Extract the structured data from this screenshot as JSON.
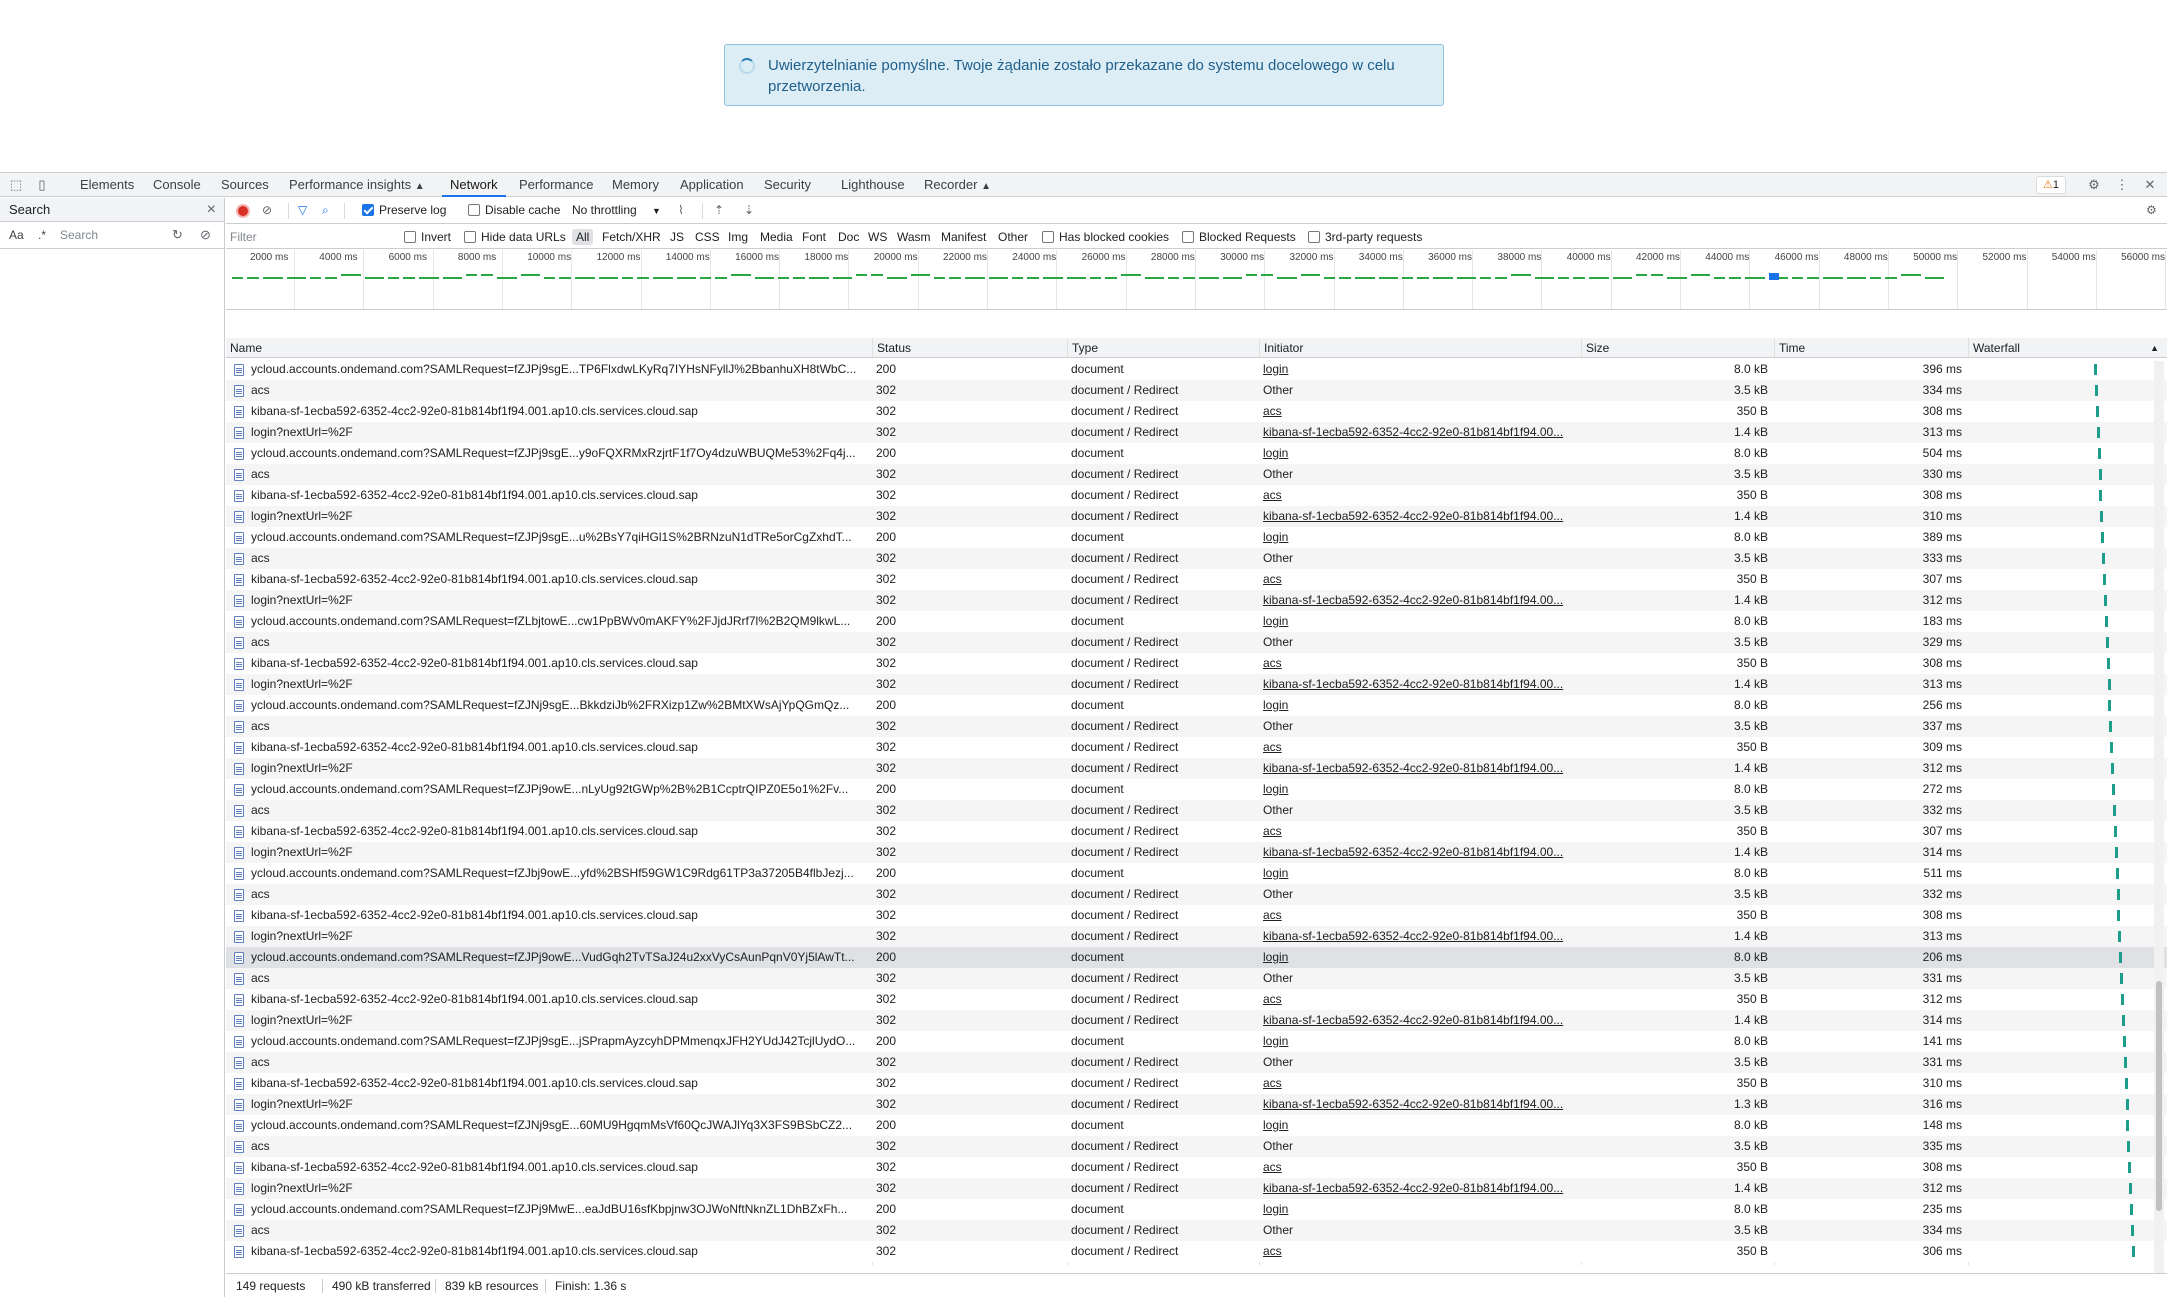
{
  "alert": {
    "message": "Uwierzytelnianie pomyślne. Twoje żądanie zostało przekazane do systemu docelowego w celu przetworzenia."
  },
  "devtools": {
    "tabs": [
      "Elements",
      "Console",
      "Sources",
      "Performance insights",
      "Network",
      "Performance",
      "Memory",
      "Application",
      "Security",
      "Lighthouse",
      "Recorder"
    ],
    "active_tab": "Network",
    "warnings": "1",
    "warn_symbol": "⚠"
  },
  "search_panel": {
    "title": "Search",
    "case_toggle": "Aa",
    "regex_toggle": ".*",
    "placeholder": "Search"
  },
  "toolbar": {
    "preserve_log": "Preserve log",
    "disable_cache": "Disable cache",
    "throttling": "No throttling"
  },
  "filterbar": {
    "placeholder": "Filter",
    "invert": "Invert",
    "hide_data_urls": "Hide data URLs",
    "types": [
      "All",
      "Fetch/XHR",
      "JS",
      "CSS",
      "Img",
      "Media",
      "Font",
      "Doc",
      "WS",
      "Wasm",
      "Manifest",
      "Other"
    ],
    "has_blocked_cookies": "Has blocked cookies",
    "blocked_requests": "Blocked Requests",
    "third_party": "3rd-party requests"
  },
  "overview": {
    "ticks": [
      "2000 ms",
      "4000 ms",
      "6000 ms",
      "8000 ms",
      "10000 ms",
      "12000 ms",
      "14000 ms",
      "16000 ms",
      "18000 ms",
      "20000 ms",
      "22000 ms",
      "24000 ms",
      "26000 ms",
      "28000 ms",
      "30000 ms",
      "32000 ms",
      "34000 ms",
      "36000 ms",
      "38000 ms",
      "40000 ms",
      "42000 ms",
      "44000 ms",
      "46000 ms",
      "48000 ms",
      "50000 ms",
      "52000 ms",
      "54000 ms",
      "56000 ms"
    ]
  },
  "columns": {
    "name": "Name",
    "status": "Status",
    "type": "Type",
    "initiator": "Initiator",
    "size": "Size",
    "time": "Time",
    "waterfall": "Waterfall"
  },
  "rows": [
    {
      "name": "ycloud.accounts.ondemand.com?SAMLRequest=fZJPj9sgE...TP6FlxdwLKyRq7IYHsNFyllJ%2BbanhuXH8tWbC...",
      "status": "200",
      "type": "document",
      "initiator": "login",
      "link": true,
      "size": "8.0 kB",
      "time": "396 ms"
    },
    {
      "name": "acs",
      "status": "302",
      "type": "document / Redirect",
      "initiator": "Other",
      "link": false,
      "size": "3.5 kB",
      "time": "334 ms"
    },
    {
      "name": "kibana-sf-1ecba592-6352-4cc2-92e0-81b814bf1f94.001.ap10.cls.services.cloud.sap",
      "status": "302",
      "type": "document / Redirect",
      "initiator": "acs",
      "link": true,
      "size": "350 B",
      "time": "308 ms"
    },
    {
      "name": "login?nextUrl=%2F",
      "status": "302",
      "type": "document / Redirect",
      "initiator": "kibana-sf-1ecba592-6352-4cc2-92e0-81b814bf1f94.00...",
      "link": true,
      "size": "1.4 kB",
      "time": "313 ms"
    },
    {
      "name": "ycloud.accounts.ondemand.com?SAMLRequest=fZJPj9sgE...y9oFQXRMxRzjrtF1f7Oy4dzuWBUQMe53%2Fq4j...",
      "status": "200",
      "type": "document",
      "initiator": "login",
      "link": true,
      "size": "8.0 kB",
      "time": "504 ms"
    },
    {
      "name": "acs",
      "status": "302",
      "type": "document / Redirect",
      "initiator": "Other",
      "link": false,
      "size": "3.5 kB",
      "time": "330 ms"
    },
    {
      "name": "kibana-sf-1ecba592-6352-4cc2-92e0-81b814bf1f94.001.ap10.cls.services.cloud.sap",
      "status": "302",
      "type": "document / Redirect",
      "initiator": "acs",
      "link": true,
      "size": "350 B",
      "time": "308 ms"
    },
    {
      "name": "login?nextUrl=%2F",
      "status": "302",
      "type": "document / Redirect",
      "initiator": "kibana-sf-1ecba592-6352-4cc2-92e0-81b814bf1f94.00...",
      "link": true,
      "size": "1.4 kB",
      "time": "310 ms"
    },
    {
      "name": "ycloud.accounts.ondemand.com?SAMLRequest=fZJPj9sgE...u%2BsY7qiHGl1S%2BRNzuN1dTRe5orCgZxhdT...",
      "status": "200",
      "type": "document",
      "initiator": "login",
      "link": true,
      "size": "8.0 kB",
      "time": "389 ms"
    },
    {
      "name": "acs",
      "status": "302",
      "type": "document / Redirect",
      "initiator": "Other",
      "link": false,
      "size": "3.5 kB",
      "time": "333 ms"
    },
    {
      "name": "kibana-sf-1ecba592-6352-4cc2-92e0-81b814bf1f94.001.ap10.cls.services.cloud.sap",
      "status": "302",
      "type": "document / Redirect",
      "initiator": "acs",
      "link": true,
      "size": "350 B",
      "time": "307 ms"
    },
    {
      "name": "login?nextUrl=%2F",
      "status": "302",
      "type": "document / Redirect",
      "initiator": "kibana-sf-1ecba592-6352-4cc2-92e0-81b814bf1f94.00...",
      "link": true,
      "size": "1.4 kB",
      "time": "312 ms"
    },
    {
      "name": "ycloud.accounts.ondemand.com?SAMLRequest=fZLbjtowE...cw1PpBWv0mAKFY%2FJjdJRrf7l%2B2QM9lkwL...",
      "status": "200",
      "type": "document",
      "initiator": "login",
      "link": true,
      "size": "8.0 kB",
      "time": "183 ms"
    },
    {
      "name": "acs",
      "status": "302",
      "type": "document / Redirect",
      "initiator": "Other",
      "link": false,
      "size": "3.5 kB",
      "time": "329 ms"
    },
    {
      "name": "kibana-sf-1ecba592-6352-4cc2-92e0-81b814bf1f94.001.ap10.cls.services.cloud.sap",
      "status": "302",
      "type": "document / Redirect",
      "initiator": "acs",
      "link": true,
      "size": "350 B",
      "time": "308 ms"
    },
    {
      "name": "login?nextUrl=%2F",
      "status": "302",
      "type": "document / Redirect",
      "initiator": "kibana-sf-1ecba592-6352-4cc2-92e0-81b814bf1f94.00...",
      "link": true,
      "size": "1.4 kB",
      "time": "313 ms"
    },
    {
      "name": "ycloud.accounts.ondemand.com?SAMLRequest=fZJNj9sgE...BkkdziJb%2FRXizp1Zw%2BMtXWsAjYpQGmQz...",
      "status": "200",
      "type": "document",
      "initiator": "login",
      "link": true,
      "size": "8.0 kB",
      "time": "256 ms"
    },
    {
      "name": "acs",
      "status": "302",
      "type": "document / Redirect",
      "initiator": "Other",
      "link": false,
      "size": "3.5 kB",
      "time": "337 ms"
    },
    {
      "name": "kibana-sf-1ecba592-6352-4cc2-92e0-81b814bf1f94.001.ap10.cls.services.cloud.sap",
      "status": "302",
      "type": "document / Redirect",
      "initiator": "acs",
      "link": true,
      "size": "350 B",
      "time": "309 ms"
    },
    {
      "name": "login?nextUrl=%2F",
      "status": "302",
      "type": "document / Redirect",
      "initiator": "kibana-sf-1ecba592-6352-4cc2-92e0-81b814bf1f94.00...",
      "link": true,
      "size": "1.4 kB",
      "time": "312 ms"
    },
    {
      "name": "ycloud.accounts.ondemand.com?SAMLRequest=fZJPj9owE...nLyUg92tGWp%2B%2B1CcptrQIPZ0E5o1%2Fv...",
      "status": "200",
      "type": "document",
      "initiator": "login",
      "link": true,
      "size": "8.0 kB",
      "time": "272 ms"
    },
    {
      "name": "acs",
      "status": "302",
      "type": "document / Redirect",
      "initiator": "Other",
      "link": false,
      "size": "3.5 kB",
      "time": "332 ms"
    },
    {
      "name": "kibana-sf-1ecba592-6352-4cc2-92e0-81b814bf1f94.001.ap10.cls.services.cloud.sap",
      "status": "302",
      "type": "document / Redirect",
      "initiator": "acs",
      "link": true,
      "size": "350 B",
      "time": "307 ms"
    },
    {
      "name": "login?nextUrl=%2F",
      "status": "302",
      "type": "document / Redirect",
      "initiator": "kibana-sf-1ecba592-6352-4cc2-92e0-81b814bf1f94.00...",
      "link": true,
      "size": "1.4 kB",
      "time": "314 ms"
    },
    {
      "name": "ycloud.accounts.ondemand.com?SAMLRequest=fZJbj9owE...yfd%2BSHf59GW1C9Rdg61TP3a37205B4flbJezj...",
      "status": "200",
      "type": "document",
      "initiator": "login",
      "link": true,
      "size": "8.0 kB",
      "time": "511 ms"
    },
    {
      "name": "acs",
      "status": "302",
      "type": "document / Redirect",
      "initiator": "Other",
      "link": false,
      "size": "3.5 kB",
      "time": "332 ms"
    },
    {
      "name": "kibana-sf-1ecba592-6352-4cc2-92e0-81b814bf1f94.001.ap10.cls.services.cloud.sap",
      "status": "302",
      "type": "document / Redirect",
      "initiator": "acs",
      "link": true,
      "size": "350 B",
      "time": "308 ms"
    },
    {
      "name": "login?nextUrl=%2F",
      "status": "302",
      "type": "document / Redirect",
      "initiator": "kibana-sf-1ecba592-6352-4cc2-92e0-81b814bf1f94.00...",
      "link": true,
      "size": "1.4 kB",
      "time": "313 ms"
    },
    {
      "name": "ycloud.accounts.ondemand.com?SAMLRequest=fZJPj9owE...VudGqh2TvTSaJ24u2xxVyCsAunPqnV0Yj5lAwTt...",
      "status": "200",
      "type": "document",
      "initiator": "login",
      "link": true,
      "size": "8.0 kB",
      "time": "206 ms",
      "selected": true
    },
    {
      "name": "acs",
      "status": "302",
      "type": "document / Redirect",
      "initiator": "Other",
      "link": false,
      "size": "3.5 kB",
      "time": "331 ms"
    },
    {
      "name": "kibana-sf-1ecba592-6352-4cc2-92e0-81b814bf1f94.001.ap10.cls.services.cloud.sap",
      "status": "302",
      "type": "document / Redirect",
      "initiator": "acs",
      "link": true,
      "size": "350 B",
      "time": "312 ms"
    },
    {
      "name": "login?nextUrl=%2F",
      "status": "302",
      "type": "document / Redirect",
      "initiator": "kibana-sf-1ecba592-6352-4cc2-92e0-81b814bf1f94.00...",
      "link": true,
      "size": "1.4 kB",
      "time": "314 ms"
    },
    {
      "name": "ycloud.accounts.ondemand.com?SAMLRequest=fZJPj9sgE...jSPrapmAyzcyhDPMmenqxJFH2YUdJ42TcjlUydO...",
      "status": "200",
      "type": "document",
      "initiator": "login",
      "link": true,
      "size": "8.0 kB",
      "time": "141 ms"
    },
    {
      "name": "acs",
      "status": "302",
      "type": "document / Redirect",
      "initiator": "Other",
      "link": false,
      "size": "3.5 kB",
      "time": "331 ms"
    },
    {
      "name": "kibana-sf-1ecba592-6352-4cc2-92e0-81b814bf1f94.001.ap10.cls.services.cloud.sap",
      "status": "302",
      "type": "document / Redirect",
      "initiator": "acs",
      "link": true,
      "size": "350 B",
      "time": "310 ms"
    },
    {
      "name": "login?nextUrl=%2F",
      "status": "302",
      "type": "document / Redirect",
      "initiator": "kibana-sf-1ecba592-6352-4cc2-92e0-81b814bf1f94.00...",
      "link": true,
      "size": "1.3 kB",
      "time": "316 ms"
    },
    {
      "name": "ycloud.accounts.ondemand.com?SAMLRequest=fZJNj9sgE...60MU9HgqmMsVf60QcJWAJlYq3X3FS9BSbCZ2...",
      "status": "200",
      "type": "document",
      "initiator": "login",
      "link": true,
      "size": "8.0 kB",
      "time": "148 ms"
    },
    {
      "name": "acs",
      "status": "302",
      "type": "document / Redirect",
      "initiator": "Other",
      "link": false,
      "size": "3.5 kB",
      "time": "335 ms"
    },
    {
      "name": "kibana-sf-1ecba592-6352-4cc2-92e0-81b814bf1f94.001.ap10.cls.services.cloud.sap",
      "status": "302",
      "type": "document / Redirect",
      "initiator": "acs",
      "link": true,
      "size": "350 B",
      "time": "308 ms"
    },
    {
      "name": "login?nextUrl=%2F",
      "status": "302",
      "type": "document / Redirect",
      "initiator": "kibana-sf-1ecba592-6352-4cc2-92e0-81b814bf1f94.00...",
      "link": true,
      "size": "1.4 kB",
      "time": "312 ms"
    },
    {
      "name": "ycloud.accounts.ondemand.com?SAMLRequest=fZJPj9MwE...eaJdBU16sfKbpjnw3OJWoNftNknZL1DhBZxFh...",
      "status": "200",
      "type": "document",
      "initiator": "login",
      "link": true,
      "size": "8.0 kB",
      "time": "235 ms"
    },
    {
      "name": "acs",
      "status": "302",
      "type": "document / Redirect",
      "initiator": "Other",
      "link": false,
      "size": "3.5 kB",
      "time": "334 ms"
    },
    {
      "name": "kibana-sf-1ecba592-6352-4cc2-92e0-81b814bf1f94.001.ap10.cls.services.cloud.sap",
      "status": "302",
      "type": "document / Redirect",
      "initiator": "acs",
      "link": true,
      "size": "350 B",
      "time": "306 ms"
    }
  ],
  "statusbar": {
    "requests": "149 requests",
    "transferred": "490 kB transferred",
    "resources": "839 kB resources",
    "finish": "Finish: 1.36 s"
  },
  "colors": {
    "accent": "#1a73e8",
    "record": "#d93025",
    "waterfall": "#1e9e8a",
    "timeline": "#28a745"
  }
}
